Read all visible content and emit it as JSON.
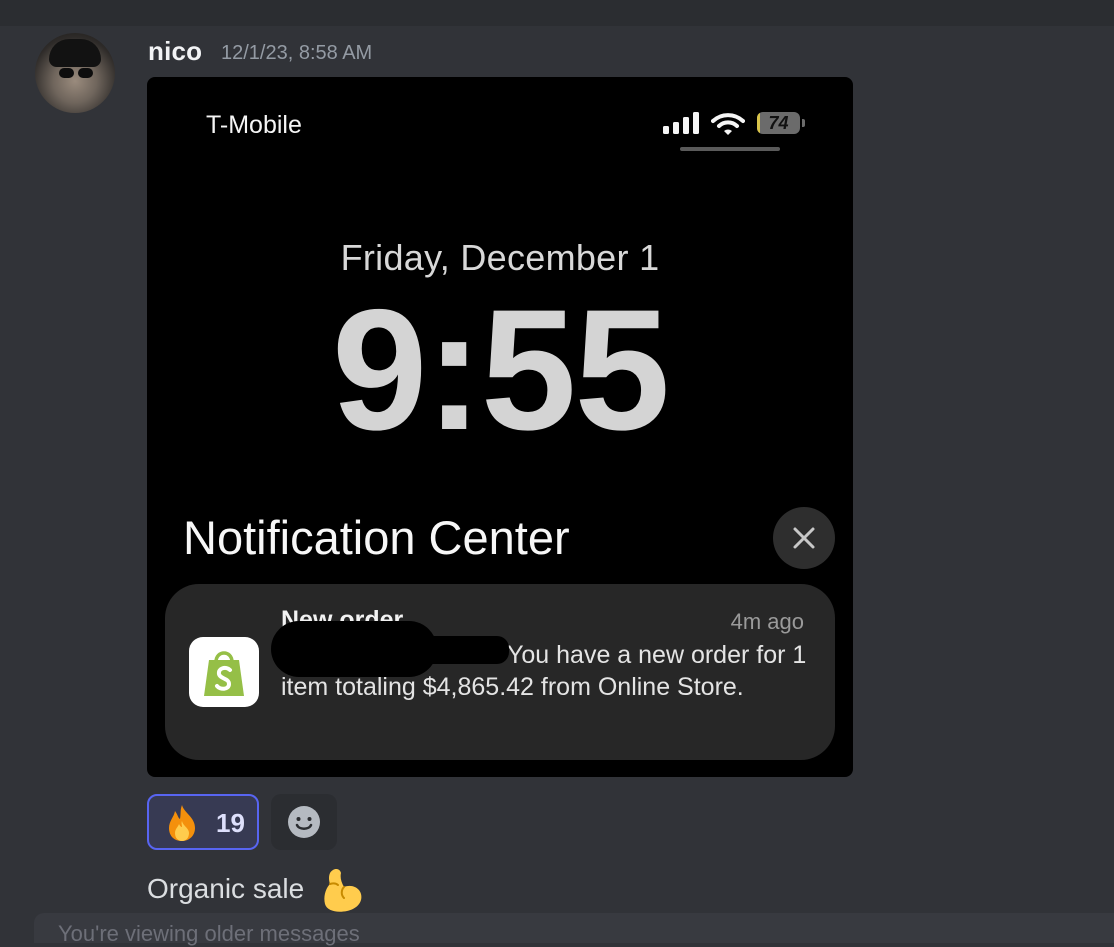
{
  "message": {
    "author": "nico",
    "timestamp": "12/1/23, 8:58 AM",
    "text": "Organic sale",
    "text_emoji": "flexed-biceps-emoji"
  },
  "screenshot": {
    "carrier": "T-Mobile",
    "battery_level": "74",
    "date": "Friday, December 1",
    "time": "9:55",
    "notification_center_title": "Notification Center",
    "notification": {
      "app_icon": "shopify-icon",
      "title": "New order",
      "time_ago": "4m ago",
      "body": "You have a new order for 1 item totaling $4,865.42 from Online Store."
    }
  },
  "reactions": [
    {
      "emoji": "fire-emoji",
      "count": "19",
      "selected": true
    }
  ],
  "composer": {
    "partial_text": "You're viewing older messages"
  },
  "colors": {
    "background": "#313338",
    "reaction_border": "#5865f2",
    "shopify_green": "#95bf47"
  }
}
